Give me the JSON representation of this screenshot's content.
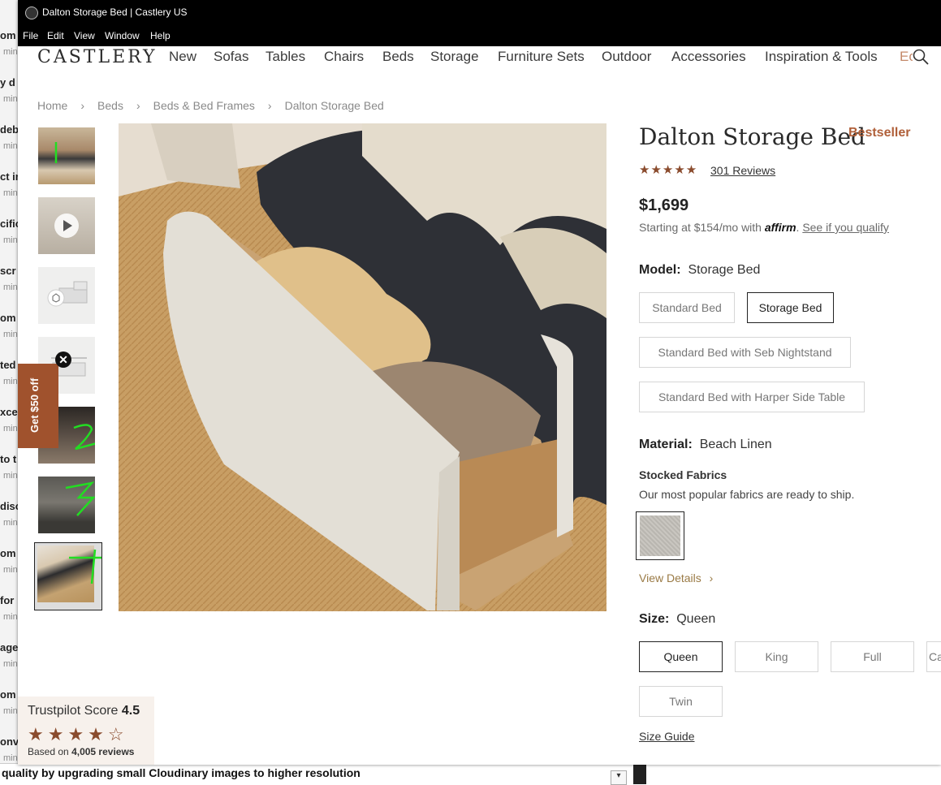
{
  "window": {
    "title": "Dalton Storage Bed | Castlery US",
    "menu": [
      "File",
      "Edit",
      "View",
      "Window",
      "Help"
    ]
  },
  "background_window": {
    "items": [
      {
        "title": "om F",
        "meta": "min"
      },
      {
        "title": "y d",
        "meta": "min"
      },
      {
        "title": "deb",
        "meta": "min"
      },
      {
        "title": "ct in",
        "meta": "min"
      },
      {
        "title": "cific",
        "meta": "min"
      },
      {
        "title": "scr",
        "meta": "min"
      },
      {
        "title": "om F",
        "meta": "min"
      },
      {
        "title": "ted",
        "meta": "min"
      },
      {
        "title": "xce",
        "meta": "min"
      },
      {
        "title": "to t",
        "meta": "min"
      },
      {
        "title": "disc",
        "meta": "min"
      },
      {
        "title": "om F",
        "meta": "min"
      },
      {
        "title": "for",
        "meta": "min"
      },
      {
        "title": "age",
        "meta": "min"
      },
      {
        "title": "om F",
        "meta": "min"
      },
      {
        "title": "onv",
        "meta": "min"
      }
    ],
    "bottom_text": "quality by upgrading small Cloudinary images to higher resolution"
  },
  "site": {
    "logo": "CASTLERY",
    "nav": [
      "New",
      "Sofas",
      "Tables",
      "Chairs",
      "Beds",
      "Storage",
      "Furniture Sets",
      "Outdoor",
      "Accessories",
      "Inspiration & Tools"
    ],
    "nav_cut": "Ec"
  },
  "breadcrumb": [
    "Home",
    "Beds",
    "Beds & Bed Frames",
    "Dalton Storage Bed"
  ],
  "breadcrumb_sep": "›",
  "promo": {
    "label": "Get $50 off",
    "close": "✕"
  },
  "trustpilot": {
    "score_label": "Trustpilot Score",
    "score": "4.5",
    "stars": "★★★★☆",
    "based_prefix": "Based on",
    "based_count": "4,005 reviews"
  },
  "product": {
    "title": "Dalton Storage Bed",
    "badge": "Bestseller",
    "rating_stars": "★★★★★",
    "reviews": "301 Reviews",
    "price": "$1,699",
    "affirm_prefix": "Starting at $154/mo with",
    "affirm_logo": "affirm",
    "affirm_link": "See if you qualify",
    "model_label": "Model:",
    "model_value": "Storage Bed",
    "models": [
      "Standard Bed",
      "Storage Bed",
      "Standard Bed with Seb Nightstand",
      "Standard Bed with Harper Side Table"
    ],
    "material_label": "Material:",
    "material_value": "Beach Linen",
    "stocked_title": "Stocked Fabrics",
    "stocked_sub": "Our most popular fabrics are ready to ship.",
    "view_details": "View Details",
    "size_label": "Size:",
    "size_value": "Queen",
    "sizes": [
      "Queen",
      "King",
      "Full",
      "Ca",
      "Twin"
    ],
    "size_guide": "Size Guide"
  }
}
